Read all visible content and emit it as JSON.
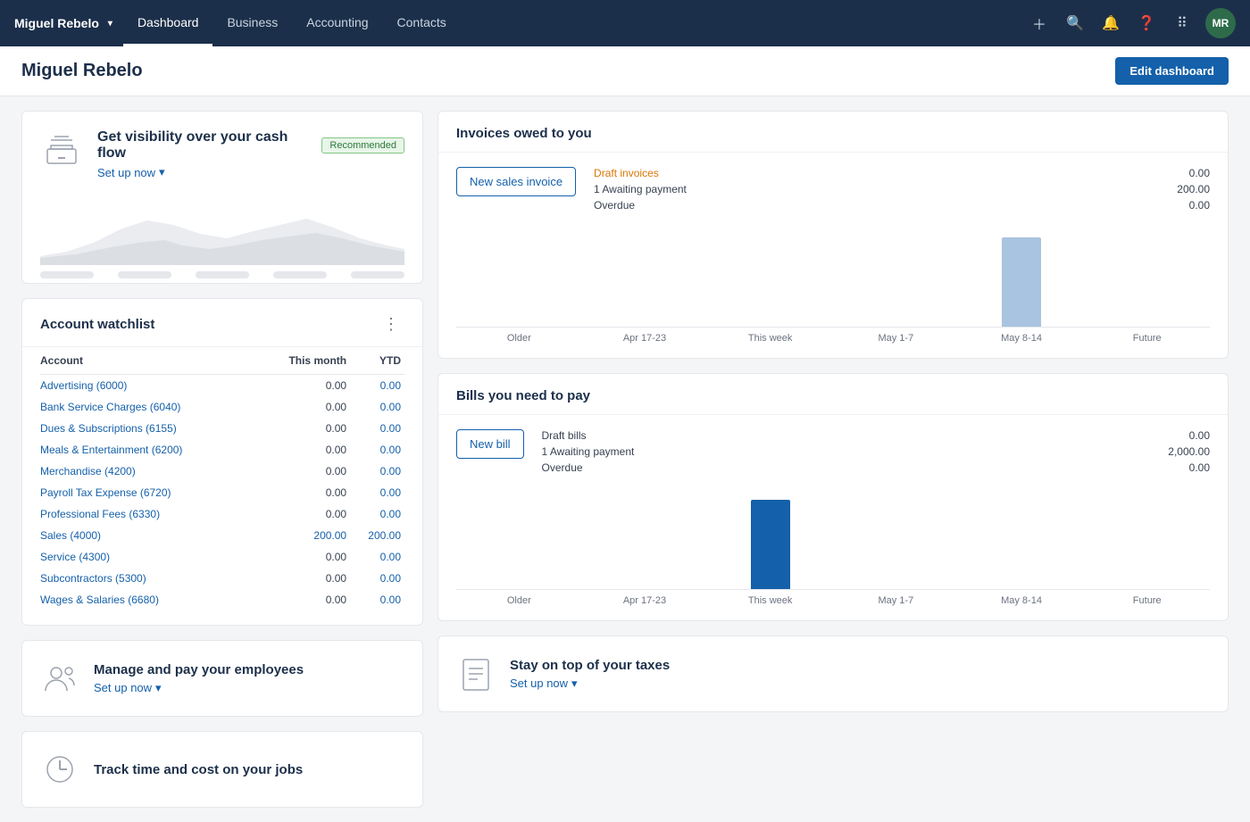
{
  "nav": {
    "brand": "Miguel Rebelo",
    "links": [
      {
        "label": "Dashboard",
        "active": true
      },
      {
        "label": "Business",
        "active": false
      },
      {
        "label": "Accounting",
        "active": false
      },
      {
        "label": "Contacts",
        "active": false
      }
    ],
    "avatar": "MR"
  },
  "page": {
    "title": "Miguel Rebelo",
    "edit_btn": "Edit dashboard"
  },
  "cashflow": {
    "title": "Get visibility over your cash flow",
    "badge": "Recommended",
    "setup_link": "Set up now"
  },
  "watchlist": {
    "title": "Account watchlist",
    "col_account": "Account",
    "col_month": "This month",
    "col_ytd": "YTD",
    "rows": [
      {
        "account": "Advertising (6000)",
        "month": "0.00",
        "ytd": "0.00"
      },
      {
        "account": "Bank Service Charges (6040)",
        "month": "0.00",
        "ytd": "0.00"
      },
      {
        "account": "Dues & Subscriptions (6155)",
        "month": "0.00",
        "ytd": "0.00"
      },
      {
        "account": "Meals & Entertainment (6200)",
        "month": "0.00",
        "ytd": "0.00"
      },
      {
        "account": "Merchandise (4200)",
        "month": "0.00",
        "ytd": "0.00"
      },
      {
        "account": "Payroll Tax Expense (6720)",
        "month": "0.00",
        "ytd": "0.00"
      },
      {
        "account": "Professional Fees (6330)",
        "month": "0.00",
        "ytd": "0.00"
      },
      {
        "account": "Sales (4000)",
        "month": "200.00",
        "ytd": "200.00"
      },
      {
        "account": "Service (4300)",
        "month": "0.00",
        "ytd": "0.00"
      },
      {
        "account": "Subcontractors (5300)",
        "month": "0.00",
        "ytd": "0.00"
      },
      {
        "account": "Wages & Salaries (6680)",
        "month": "0.00",
        "ytd": "0.00"
      }
    ]
  },
  "employees": {
    "title": "Manage and pay your employees",
    "setup_link": "Set up now"
  },
  "track_jobs": {
    "title": "Track time and cost on your jobs"
  },
  "invoices": {
    "title": "Invoices owed to you",
    "new_btn": "New sales invoice",
    "stats": [
      {
        "label": "Draft invoices",
        "value": "0.00",
        "orange": true
      },
      {
        "label": "1 Awaiting payment",
        "value": "200.00",
        "orange": false
      },
      {
        "label": "Overdue",
        "value": "0.00",
        "orange": false
      }
    ],
    "chart_labels": [
      "Older",
      "Apr 17-23",
      "This week",
      "May 1-7",
      "May 8-14",
      "Future"
    ],
    "chart_bars": [
      0,
      0,
      0,
      0,
      90,
      0
    ],
    "bar_color": "light-blue"
  },
  "bills": {
    "title": "Bills you need to pay",
    "new_btn": "New bill",
    "stats": [
      {
        "label": "Draft bills",
        "value": "0.00",
        "orange": false
      },
      {
        "label": "1 Awaiting payment",
        "value": "2,000.00",
        "orange": false
      },
      {
        "label": "Overdue",
        "value": "0.00",
        "orange": false
      }
    ],
    "chart_labels": [
      "Older",
      "Apr 17-23",
      "This week",
      "May 1-7",
      "May 8-14",
      "Future"
    ],
    "chart_bars": [
      0,
      0,
      90,
      0,
      0,
      0
    ],
    "bar_color": "blue"
  },
  "taxes": {
    "title": "Stay on top of your taxes",
    "setup_link": "Set up now"
  }
}
